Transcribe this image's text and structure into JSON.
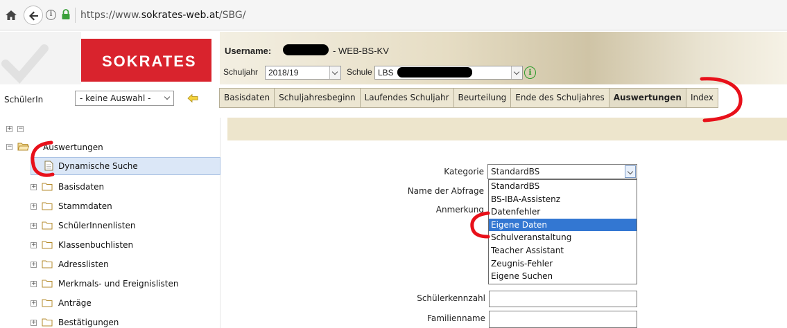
{
  "browser": {
    "url_prefix": "https://www.",
    "url_domain": "sokrates-web.at",
    "url_path": "/SBG/",
    "info_glyph": "i"
  },
  "header": {
    "logo_text": "SOKRATES",
    "username_label": "Username:",
    "username_suffix": "- WEB-BS-KV",
    "schuljahr_label": "Schuljahr",
    "schuljahr_value": "2018/19",
    "schule_label": "Schule",
    "schule_value": "LBS",
    "school_info_glyph": "i"
  },
  "student": {
    "label": "SchülerIn",
    "select_value": "- keine Auswahl -"
  },
  "tabs": [
    {
      "label": "Basisdaten"
    },
    {
      "label": "Schuljahresbeginn"
    },
    {
      "label": "Laufendes Schuljahr"
    },
    {
      "label": "Beurteilung"
    },
    {
      "label": "Ende des Schuljahres"
    },
    {
      "label": "Auswertungen",
      "active": true
    },
    {
      "label": "Index"
    }
  ],
  "tree": {
    "root_label": "Auswertungen",
    "selected_label": "Dynamische Suche",
    "items": [
      {
        "label": "Basisdaten"
      },
      {
        "label": "Stammdaten"
      },
      {
        "label": "SchülerInnenlisten"
      },
      {
        "label": "Klassenbuchlisten"
      },
      {
        "label": "Adresslisten"
      },
      {
        "label": "Merkmals- und Ereignislisten"
      },
      {
        "label": "Anträge"
      },
      {
        "label": "Bestätigungen"
      }
    ]
  },
  "form": {
    "kategorie_label": "Kategorie",
    "kategorie_value": "StandardBS",
    "name_label": "Name der Abfrage",
    "anmerkung_label": "Anmerkung",
    "schuelerkennzahl_label": "Schülerkennzahl",
    "familienname_label": "Familienname",
    "dropdown_options": [
      {
        "label": "StandardBS"
      },
      {
        "label": "BS-IBA-Assistenz"
      },
      {
        "label": "Datenfehler"
      },
      {
        "label": "Eigene Daten",
        "highlighted": true
      },
      {
        "label": "Schulveranstaltung"
      },
      {
        "label": "Teacher Assistant"
      },
      {
        "label": "Zeugnis-Fehler"
      },
      {
        "label": "Eigene Suchen"
      }
    ]
  },
  "colors": {
    "brand_red": "#d9232d",
    "tab_bg": "#ece6d2",
    "highlight_blue": "#3377d2",
    "annotation_red": "#e8101a"
  }
}
